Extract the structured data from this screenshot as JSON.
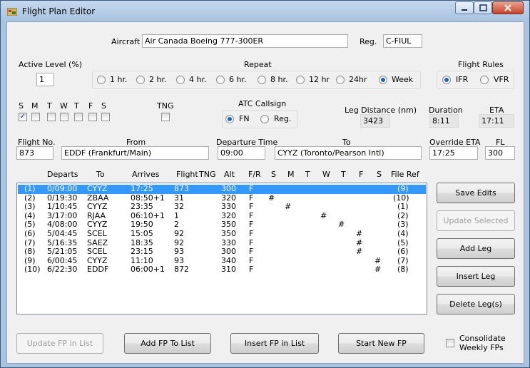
{
  "window": {
    "title": "Flight Plan Editor"
  },
  "aircraft": {
    "label": "Aircraft",
    "value": "Air Canada Boeing 777-300ER"
  },
  "reg": {
    "label": "Reg.",
    "value": "C-FIUL"
  },
  "active_level": {
    "label": "Active Level (%)",
    "value": "1"
  },
  "repeat": {
    "label": "Repeat",
    "options": [
      "1 hr.",
      "2 hr.",
      "4 hr.",
      "6 hr.",
      "8 hr.",
      "12 hr",
      "24hr",
      "Week"
    ],
    "selected": "Week"
  },
  "flight_rules": {
    "label": "Flight Rules",
    "options": [
      "IFR",
      "VFR"
    ],
    "selected": "IFR"
  },
  "days": {
    "labels": [
      "S",
      "M",
      "T",
      "W",
      "T",
      "F",
      "S"
    ],
    "checked": [
      true,
      false,
      false,
      false,
      false,
      false,
      false
    ]
  },
  "tng": {
    "label": "TNG",
    "checked": false
  },
  "atc_callsign": {
    "label": "ATC Callsign",
    "options": [
      "FN",
      "Reg."
    ],
    "selected": "FN"
  },
  "leg_distance": {
    "label": "Leg Distance (nm)",
    "value": "3423"
  },
  "duration": {
    "label": "Duration",
    "value": "8:11"
  },
  "eta": {
    "label": "ETA",
    "value": "17:11"
  },
  "flight_no": {
    "label": "Flight No.",
    "value": "873"
  },
  "from": {
    "label": "From",
    "value": "EDDF (Frankfurt/Main)"
  },
  "departure_time": {
    "label": "Departure Time",
    "value": "09:00"
  },
  "to": {
    "label": "To",
    "value": "CYYZ (Toronto/Pearson Intl)"
  },
  "override_eta": {
    "label": "Override ETA",
    "value": "17:25"
  },
  "fl": {
    "label": "FL",
    "value": "300"
  },
  "legs": {
    "headers": [
      "Departs",
      "To",
      "Arrives",
      "Flight",
      "TNG",
      "Alt",
      "F/R",
      "S",
      "M",
      "T",
      "W",
      "T",
      "F",
      "S",
      "File Ref"
    ],
    "rows": [
      {
        "idx": "(1)",
        "departs": "0/09:00",
        "to": "CYYZ",
        "arrives": "17:25",
        "flight": "873",
        "tng": "",
        "alt": "300",
        "fr": "F",
        "days": [
          "",
          "",
          "",
          "",
          "",
          "",
          ""
        ],
        "ref": "(9)",
        "selected": true
      },
      {
        "idx": "(2)",
        "departs": "0/19:30",
        "to": "ZBAA",
        "arrives": "08:50+1",
        "flight": "31",
        "tng": "",
        "alt": "320",
        "fr": "F",
        "days": [
          "#",
          "",
          "",
          "",
          "",
          "",
          ""
        ],
        "ref": "(10)",
        "selected": false
      },
      {
        "idx": "(3)",
        "departs": "1/10:45",
        "to": "CYYZ",
        "arrives": "23:35",
        "flight": "32",
        "tng": "",
        "alt": "330",
        "fr": "F",
        "days": [
          "",
          "#",
          "",
          "",
          "",
          "",
          ""
        ],
        "ref": "(1)",
        "selected": false
      },
      {
        "idx": "(4)",
        "departs": "3/17:00",
        "to": "RJAA",
        "arrives": "06:10+1",
        "flight": "1",
        "tng": "",
        "alt": "320",
        "fr": "F",
        "days": [
          "",
          "",
          "",
          "#",
          "",
          "",
          ""
        ],
        "ref": "(2)",
        "selected": false
      },
      {
        "idx": "(5)",
        "departs": "4/08:00",
        "to": "CYYZ",
        "arrives": "19:50",
        "flight": "2",
        "tng": "",
        "alt": "350",
        "fr": "F",
        "days": [
          "",
          "",
          "",
          "",
          "#",
          "",
          ""
        ],
        "ref": "(3)",
        "selected": false
      },
      {
        "idx": "(6)",
        "departs": "5/04:45",
        "to": "SCEL",
        "arrives": "15:05",
        "flight": "92",
        "tng": "",
        "alt": "350",
        "fr": "F",
        "days": [
          "",
          "",
          "",
          "",
          "",
          "#",
          ""
        ],
        "ref": "(4)",
        "selected": false
      },
      {
        "idx": "(7)",
        "departs": "5/16:35",
        "to": "SAEZ",
        "arrives": "18:35",
        "flight": "92",
        "tng": "",
        "alt": "330",
        "fr": "F",
        "days": [
          "",
          "",
          "",
          "",
          "",
          "#",
          ""
        ],
        "ref": "(5)",
        "selected": false
      },
      {
        "idx": "(8)",
        "departs": "5/21:05",
        "to": "SCEL",
        "arrives": "23:15",
        "flight": "93",
        "tng": "",
        "alt": "300",
        "fr": "F",
        "days": [
          "",
          "",
          "",
          "",
          "",
          "#",
          ""
        ],
        "ref": "(6)",
        "selected": false
      },
      {
        "idx": "(9)",
        "departs": "6/00:45",
        "to": "CYYZ",
        "arrives": "11:10",
        "flight": "93",
        "tng": "",
        "alt": "340",
        "fr": "F",
        "days": [
          "",
          "",
          "",
          "",
          "",
          "",
          "#"
        ],
        "ref": "(7)",
        "selected": false
      },
      {
        "idx": "(10)",
        "departs": "6/22:30",
        "to": "EDDF",
        "arrives": "06:00+1",
        "flight": "872",
        "tng": "",
        "alt": "310",
        "fr": "F",
        "days": [
          "",
          "",
          "",
          "",
          "",
          "",
          "#"
        ],
        "ref": "(8)",
        "selected": false
      }
    ]
  },
  "buttons": {
    "save_edits": "Save Edits",
    "update_selected": "Update Selected",
    "add_leg": "Add Leg",
    "insert_leg": "Insert Leg",
    "delete_legs": "Delete Leg(s)",
    "update_fp": "Update FP in List",
    "add_fp": "Add FP To List",
    "insert_fp": "Insert FP in List",
    "start_new_fp": "Start New FP"
  },
  "consolidate": {
    "label_line1": "Consolidate",
    "label_line2": "Weekly FPs",
    "checked": false
  }
}
